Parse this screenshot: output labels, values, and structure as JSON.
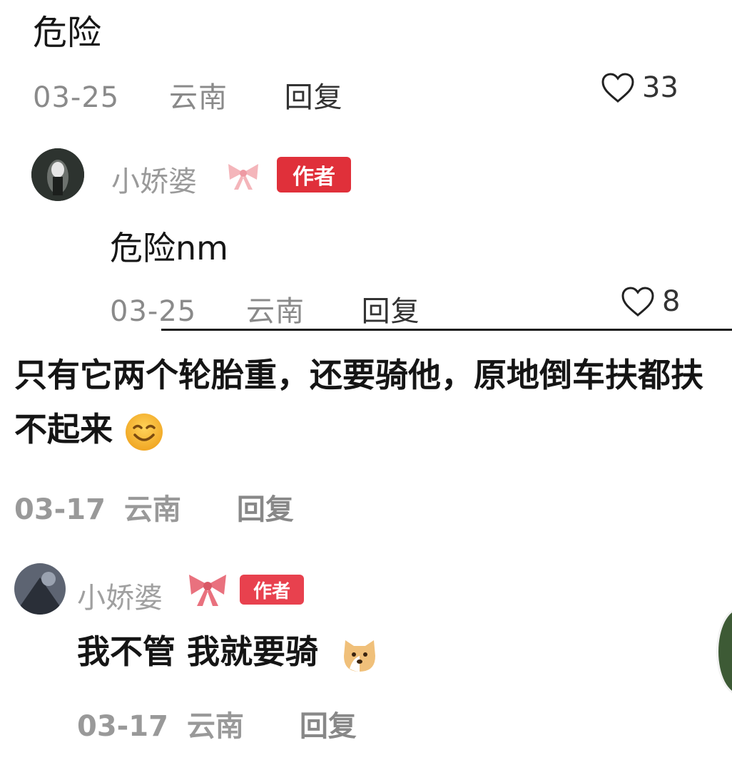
{
  "comment_top": {
    "text": "危险",
    "date": "03-25",
    "location": "云南",
    "reply_label": "回复",
    "likes": "33"
  },
  "reply_1": {
    "username": "小娇婆",
    "badge": "作者",
    "text": "危险nm",
    "date": "03-25",
    "location": "云南",
    "reply_label": "回复",
    "likes": "8"
  },
  "comment_2": {
    "text": "只有它两个轮胎重，还要骑他，原地倒车扶都扶不起来",
    "date": "03-17",
    "location": "云南",
    "reply_label": "回复",
    "emoji": "smile-emoji"
  },
  "reply_2": {
    "username": "小娇婆",
    "badge": "作者",
    "text": "我不管 我就要骑",
    "date": "03-17",
    "location": "云南",
    "reply_label": "回复",
    "emoji": "dog-emoji"
  },
  "colors": {
    "badge_red": "#e0303a",
    "bow_pink": "#f08a95"
  }
}
